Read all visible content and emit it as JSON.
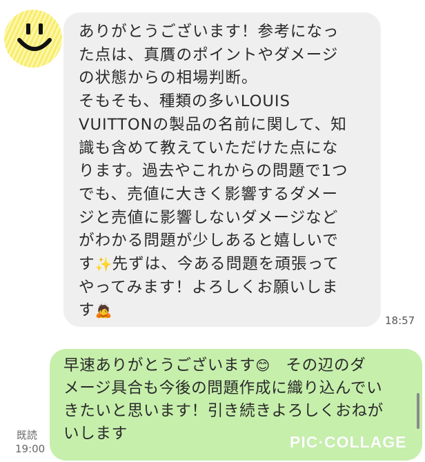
{
  "incoming_message": {
    "avatar_icon": "smiley-face-icon",
    "lines": [
      "ありがとうございます！参考になっ",
      "た点は、真贋のポイントやダメージ",
      "の状態からの相場判断。",
      "そもそも、種類の多いLOUIS",
      "VUITTONの製品の名前に関して、知",
      "識も含めて教えていただけた点にな",
      "ります。過去やこれからの問題で1つ",
      "でも、売値に大きく影響するダメー",
      "ジと売値に影響しないダメージなど",
      "がわかる問題が少しあると嬉しいで"
    ],
    "line_11_start": "す",
    "sparkle_emoji": "✨",
    "line_11_end": "先ずは、今ある問題を頑張って",
    "line_12": "やってみます！よろしくお願いしま",
    "line_13_start": "す",
    "bow_emoji": "🙇",
    "time": "18:57"
  },
  "outgoing_message": {
    "line_1_start": "早速ありがとうございます",
    "smile_emoji": "😊",
    "line_1_end": "　その辺のダ",
    "lines": [
      "メージ具合も今後の問題作成に織り込んでい",
      "きたいと思います！引き続きよろしくおねが",
      "いします"
    ],
    "read_status": "既読",
    "time": "19:00"
  },
  "watermark": "PIC·COLLAGE",
  "colors": {
    "incoming_bubble": "#efefef",
    "outgoing_bubble": "#c6efac",
    "avatar_yellow": "#f6ec6e"
  }
}
